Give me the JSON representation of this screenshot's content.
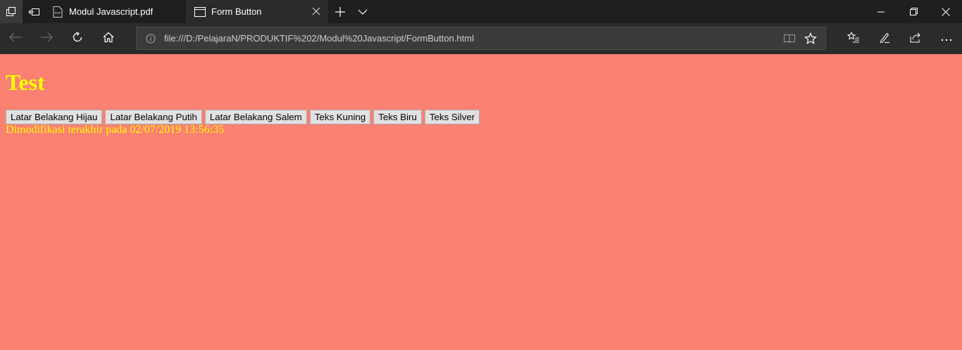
{
  "browser": {
    "tabs": [
      {
        "label": "Modul Javascript.pdf",
        "icon": "pdf-icon",
        "active": false
      },
      {
        "label": "Form Button",
        "icon": "page-icon",
        "active": true
      }
    ],
    "address": {
      "url": "file:///D:/PelajaraN/PRODUKTIF%202/Modul%20Javascript/FormButton.html"
    }
  },
  "page": {
    "heading": "Test",
    "buttons": {
      "bg_green": "Latar Belakang Hijau",
      "bg_white": "Latar Belakang Putih",
      "bg_salmon": "Latar Belakang Salem",
      "text_yellow": "Teks Kuning",
      "text_blue": "Teks Biru",
      "text_silver": "Teks Silver"
    },
    "modified_text": "Dimodifikasi terakhir pada 02/07/2019 13:56:35"
  },
  "colors": {
    "page_background": "#fa8072",
    "page_text": "#ffff00",
    "chrome_dark": "#1f1f1f",
    "chrome_mid": "#2b2b2b"
  }
}
